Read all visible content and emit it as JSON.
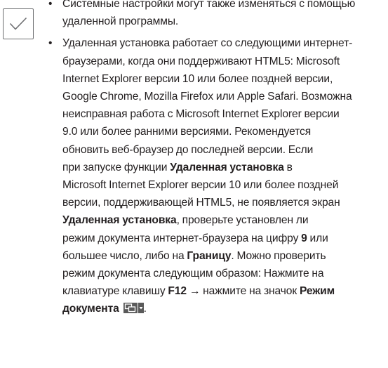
{
  "note_icon": "checkmark-note-icon",
  "bullet": "•",
  "item1": {
    "lines": [
      "Системные настройки могут также изменяться с помощью",
      "удаленной программы."
    ]
  },
  "item2": {
    "lines": [
      "Удаленная установка работает со следующими интернет-",
      "браузерами, когда они поддерживают HTML5: Microsoft",
      "Internet Explorer версии 10 или более поздней версии,",
      "Google Chrome, Mozilla Firefox или Apple Safari. Возможна",
      "неисправная работа с Microsoft Internet Explorer версии",
      "9.0 или более ранними версиями. Рекомендуется",
      "обновить веб-браузер до последней версии. Если"
    ],
    "l8_pre": "при запуске функции ",
    "l8_bold": "Удаленная установка",
    "l8_post": " в",
    "l9": "Microsoft Internet Explorer версии 10 или более поздней",
    "l10": "версии, поддерживающей HTML5, не появляется экран",
    "l11_bold": "Удаленная установка",
    "l11_post": ", проверьте установлен ли",
    "l12_pre": "режим документа интернет-браузера на цифру ",
    "l12_bold": "9",
    "l12_post": " или",
    "l13_pre": "большее число, либо на ",
    "l13_bold": "Границу",
    "l13_post": ". Можно проверить",
    "l14": "режим документа следующим образом: Нажмите на",
    "l15_pre": "клавиатуре клавишу ",
    "l15_bold": "F12",
    "l15_mid": " → нажмите на значок ",
    "l15_bold2": "Режим",
    "l16_bold": "документа",
    "l16_post": ".",
    "doc_mode_icon": "document-mode-icon"
  }
}
